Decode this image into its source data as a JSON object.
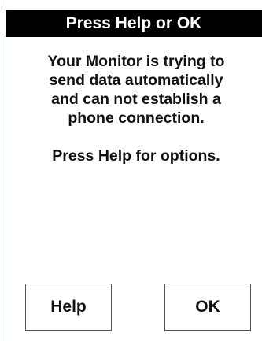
{
  "dialog": {
    "title": "Press Help or OK",
    "message_lines": [
      "Your Monitor is trying to",
      "send data automatically",
      "and can not establish a",
      "phone connection."
    ],
    "instruction": "Press Help for options."
  },
  "buttons": {
    "help_label": "Help",
    "ok_label": "OK"
  }
}
